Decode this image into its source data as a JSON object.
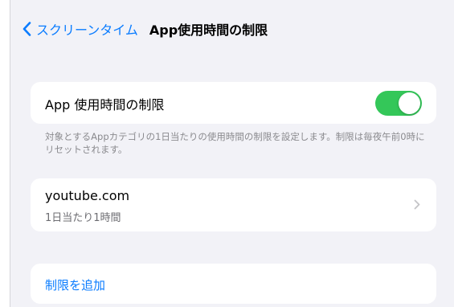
{
  "colors": {
    "accent": "#0a7cff",
    "toggle_on": "#34c759",
    "background": "#f2f2f7"
  },
  "nav": {
    "back_label": "スクリーンタイム",
    "back_icon": "chevron-left-icon",
    "title": "App使用時間の制限"
  },
  "toggle_section": {
    "label": "App 使用時間の制限",
    "state": "on",
    "footnote": "対象とするAppカテゴリの1日当たりの使用時間の制限を設定します。制限は毎夜午前0時にリセットされます。"
  },
  "limits": [
    {
      "name": "youtube.com",
      "detail": "1日当たり1時間",
      "icon": "chevron-right-icon"
    }
  ],
  "add_limit": {
    "label": "制限を追加"
  }
}
